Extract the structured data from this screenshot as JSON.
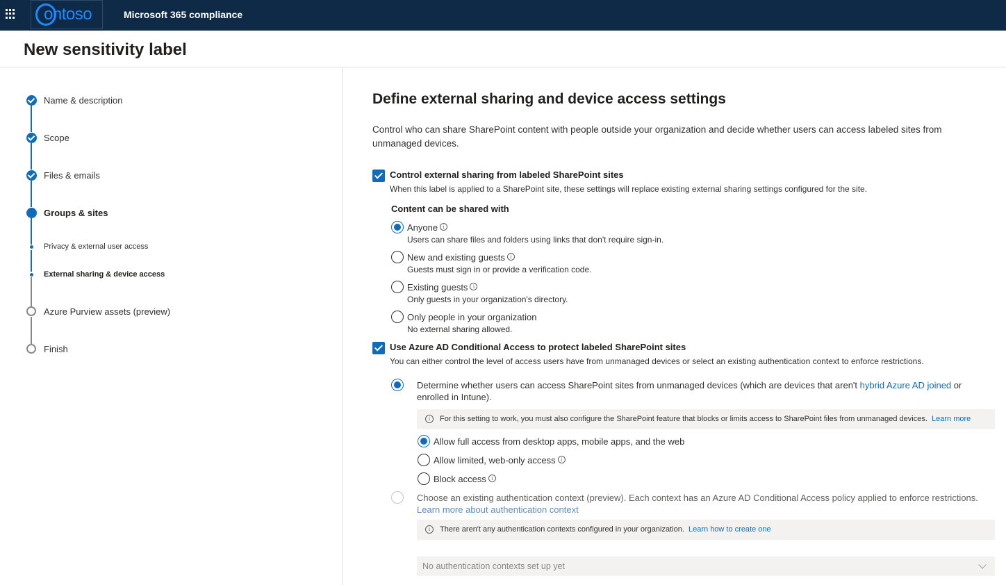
{
  "header": {
    "logo_text": "ontoso",
    "app_title": "Microsoft 365 compliance"
  },
  "page_title": "New sensitivity label",
  "steps": [
    {
      "label": "Name & description",
      "state": "done"
    },
    {
      "label": "Scope",
      "state": "done"
    },
    {
      "label": "Files & emails",
      "state": "done"
    },
    {
      "label": "Groups & sites",
      "state": "current"
    },
    {
      "label": "Privacy & external user access",
      "state": "sub-done"
    },
    {
      "label": "External sharing & device access",
      "state": "sub-current"
    },
    {
      "label": "Azure Purview assets (preview)",
      "state": "todo"
    },
    {
      "label": "Finish",
      "state": "todo"
    }
  ],
  "main": {
    "heading": "Define external sharing and device access settings",
    "intro": "Control who can share SharePoint content with people outside your organization and decide whether users can access labeled sites from unmanaged devices.",
    "sharing": {
      "checkbox_label": "Control external sharing from labeled SharePoint sites",
      "checked": true,
      "description": "When this label is applied to a SharePoint site, these settings will replace existing external sharing settings configured for the site.",
      "group_title": "Content can be shared with",
      "options": [
        {
          "label": "Anyone",
          "desc": "Users can share files and folders using links that don't require sign-in.",
          "selected": true
        },
        {
          "label": "New and existing guests",
          "desc": "Guests must sign in or provide a verification code.",
          "selected": false
        },
        {
          "label": "Existing guests",
          "desc": "Only guests in your organization's directory.",
          "selected": false
        },
        {
          "label": "Only people in your organization",
          "desc": "No external sharing allowed.",
          "selected": false
        }
      ]
    },
    "conditional": {
      "checkbox_label": "Use Azure AD Conditional Access to protect labeled SharePoint sites",
      "checked": true,
      "description": "You can either control the level of access users have from unmanaged devices or select an existing authentication context to enforce restrictions.",
      "option1": {
        "text_before": "Determine whether users can access SharePoint sites from unmanaged devices (which are devices that aren't ",
        "link": "hybrid Azure AD joined",
        "text_after": " or enrolled in Intune).",
        "notice": "For this setting to work, you must also configure the SharePoint feature that blocks or limits access to SharePoint files from unmanaged devices.",
        "notice_link": "Learn more",
        "sub_options": [
          {
            "label": "Allow full access from desktop apps, mobile apps, and the web",
            "selected": true
          },
          {
            "label": "Allow limited, web-only access",
            "selected": false
          },
          {
            "label": "Block access",
            "selected": false
          }
        ]
      },
      "option2": {
        "text": "Choose an existing authentication context (preview). Each context has an Azure AD Conditional Access policy applied to enforce restrictions. ",
        "link": "Learn more about authentication context",
        "notice": "There aren't any authentication contexts configured in your organization.",
        "notice_link": "Learn how to create one",
        "dropdown_value": "No authentication contexts set up yet"
      }
    }
  },
  "colors": {
    "topbar": "#0f2a47",
    "accent": "#0f6cbd"
  }
}
